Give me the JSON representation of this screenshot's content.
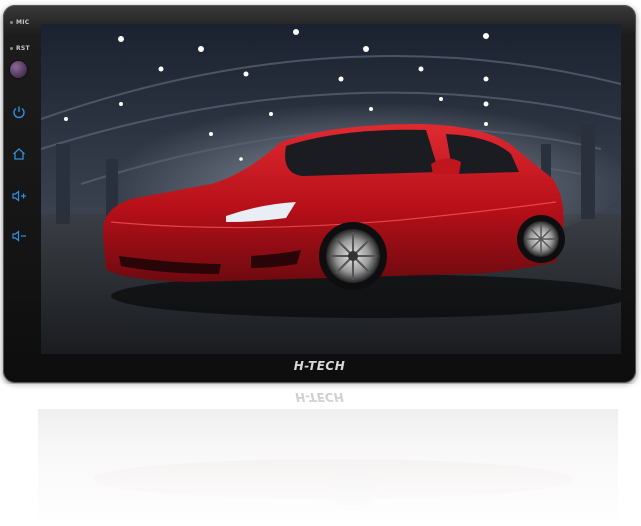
{
  "device": {
    "brand": "H-TECH",
    "side_labels": {
      "mic": "MIC",
      "reset": "RST"
    }
  },
  "side_buttons": [
    {
      "name": "power-button",
      "icon": "power-icon"
    },
    {
      "name": "home-button",
      "icon": "home-icon"
    },
    {
      "name": "volume-up-button",
      "icon": "volume-up-icon"
    },
    {
      "name": "volume-down-button",
      "icon": "volume-down-icon"
    }
  ],
  "colors": {
    "bezel": "#151515",
    "button_blue": "#2f8fe0",
    "car_red": "#c4121c"
  },
  "wallpaper": {
    "subject": "red sedan in garage"
  }
}
